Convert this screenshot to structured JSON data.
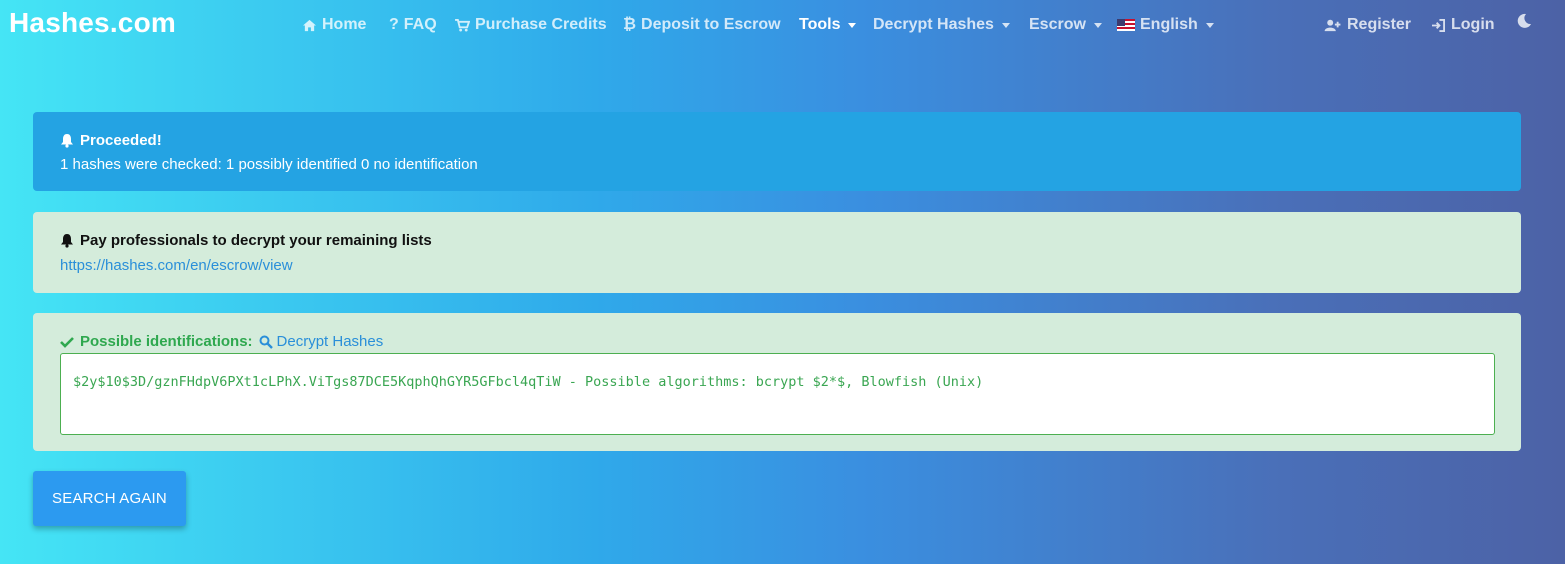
{
  "brand": "Hashes.com",
  "nav": {
    "home": "Home",
    "faq": "FAQ",
    "purchase": "Purchase Credits",
    "deposit": "Deposit to Escrow",
    "tools": "Tools",
    "decrypt": "Decrypt Hashes",
    "escrow": "Escrow",
    "language": "English",
    "register": "Register",
    "login": "Login"
  },
  "alerts": {
    "proceeded_title": "Proceeded!",
    "proceeded_text": "1 hashes were checked: 1 possibly identified 0 no identification",
    "promo_title": "Pay professionals to decrypt your remaining lists",
    "promo_link": "https://hashes.com/en/escrow/view",
    "ident_title": "Possible identifications:",
    "ident_link": "Decrypt Hashes",
    "hash_result": "$2y$10$3D/gznFHdpV6PXt1cLPhX.ViTgs87DCE5KqphQhGYR5GFbcl4qTiW - Possible algorithms: bcrypt $2*$, Blowfish (Unix)"
  },
  "search_again": "SEARCH AGAIN",
  "colors": {
    "info": "#24a3e3",
    "success_bg": "#d4ecdb",
    "success_text": "#2fa84f",
    "link": "#2a8fd9",
    "button": "#2c9af0"
  },
  "icons": [
    "home-icon",
    "question-icon",
    "cart-icon",
    "bitcoin-icon",
    "flag-us-icon",
    "user-plus-icon",
    "sign-in-icon",
    "moon-icon",
    "bell-icon",
    "check-icon",
    "search-icon"
  ]
}
